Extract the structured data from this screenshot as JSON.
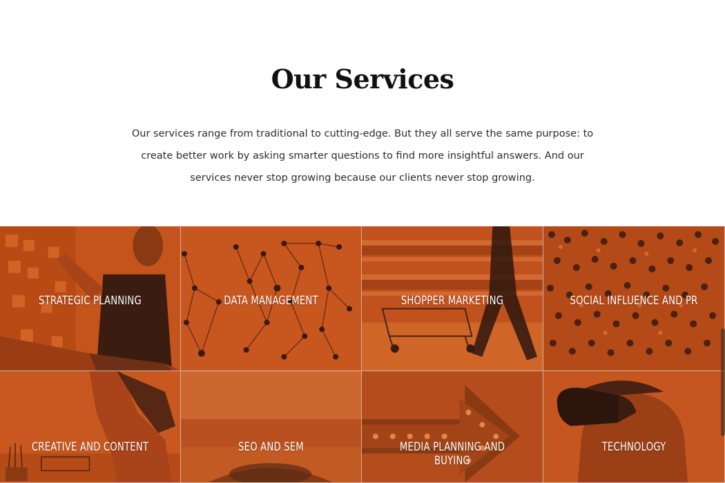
{
  "section": {
    "title": "Our Services",
    "description": "Our services range from traditional to cutting-edge. But they all serve the same purpose: to create better work by asking smarter questions to find more insightful answers. And our services never stop growing because our clients never stop growing."
  },
  "services": [
    {
      "label": "STRATEGIC PLANNING"
    },
    {
      "label": "DATA MANAGEMENT"
    },
    {
      "label": "SHOPPER MARKETING"
    },
    {
      "label": "SOCIAL INFLUENCE AND PR"
    },
    {
      "label": "CREATIVE AND CONTENT"
    },
    {
      "label": "SEO AND SEM"
    },
    {
      "label": "MEDIA PLANNING AND BUYING"
    },
    {
      "label": "TECHNOLOGY"
    }
  ],
  "colors": {
    "overlay": "#c4511a",
    "title": "#111111",
    "text": "#2b2b2b",
    "label": "#ffffff"
  }
}
